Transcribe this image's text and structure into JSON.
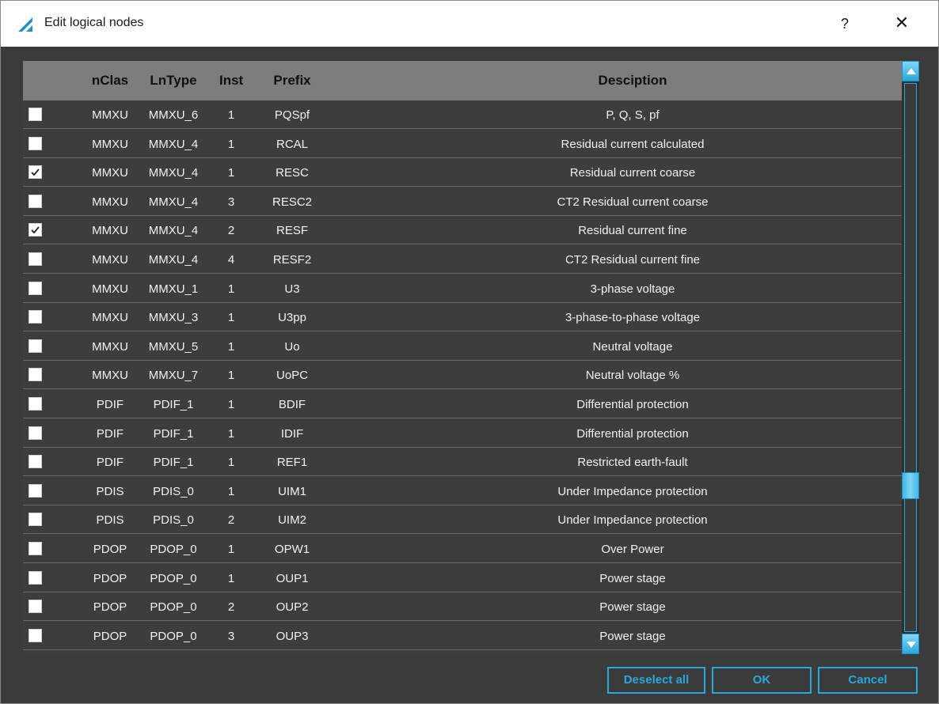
{
  "window": {
    "title": "Edit logical nodes",
    "help_label": "?",
    "close_label": "✕"
  },
  "table": {
    "headers": {
      "nclass": "nClas",
      "lntype": "LnType",
      "inst": "Inst",
      "prefix": "Prefix",
      "description": "Desciption"
    },
    "rows": [
      {
        "checked": false,
        "nclass": "MMXU",
        "lntype": "MMXU_6",
        "inst": "1",
        "prefix": "PQSpf",
        "description": "P, Q, S, pf"
      },
      {
        "checked": false,
        "nclass": "MMXU",
        "lntype": "MMXU_4",
        "inst": "1",
        "prefix": "RCAL",
        "description": "Residual current calculated"
      },
      {
        "checked": true,
        "nclass": "MMXU",
        "lntype": "MMXU_4",
        "inst": "1",
        "prefix": "RESC",
        "description": "Residual current coarse"
      },
      {
        "checked": false,
        "nclass": "MMXU",
        "lntype": "MMXU_4",
        "inst": "3",
        "prefix": "RESC2",
        "description": "CT2 Residual current coarse"
      },
      {
        "checked": true,
        "nclass": "MMXU",
        "lntype": "MMXU_4",
        "inst": "2",
        "prefix": "RESF",
        "description": "Residual current fine"
      },
      {
        "checked": false,
        "nclass": "MMXU",
        "lntype": "MMXU_4",
        "inst": "4",
        "prefix": "RESF2",
        "description": "CT2 Residual current fine"
      },
      {
        "checked": false,
        "nclass": "MMXU",
        "lntype": "MMXU_1",
        "inst": "1",
        "prefix": "U3",
        "description": "3-phase voltage"
      },
      {
        "checked": false,
        "nclass": "MMXU",
        "lntype": "MMXU_3",
        "inst": "1",
        "prefix": "U3pp",
        "description": "3-phase-to-phase voltage"
      },
      {
        "checked": false,
        "nclass": "MMXU",
        "lntype": "MMXU_5",
        "inst": "1",
        "prefix": "Uo",
        "description": "Neutral voltage"
      },
      {
        "checked": false,
        "nclass": "MMXU",
        "lntype": "MMXU_7",
        "inst": "1",
        "prefix": "UoPC",
        "description": "Neutral voltage %"
      },
      {
        "checked": false,
        "nclass": "PDIF",
        "lntype": "PDIF_1",
        "inst": "1",
        "prefix": "BDIF",
        "description": "Differential protection"
      },
      {
        "checked": false,
        "nclass": "PDIF",
        "lntype": "PDIF_1",
        "inst": "1",
        "prefix": "IDIF",
        "description": "Differential protection"
      },
      {
        "checked": false,
        "nclass": "PDIF",
        "lntype": "PDIF_1",
        "inst": "1",
        "prefix": "REF1",
        "description": "Restricted earth-fault"
      },
      {
        "checked": false,
        "nclass": "PDIS",
        "lntype": "PDIS_0",
        "inst": "1",
        "prefix": "UIM1",
        "description": "Under Impedance protection"
      },
      {
        "checked": false,
        "nclass": "PDIS",
        "lntype": "PDIS_0",
        "inst": "2",
        "prefix": "UIM2",
        "description": "Under Impedance protection"
      },
      {
        "checked": false,
        "nclass": "PDOP",
        "lntype": "PDOP_0",
        "inst": "1",
        "prefix": "OPW1",
        "description": "Over Power"
      },
      {
        "checked": false,
        "nclass": "PDOP",
        "lntype": "PDOP_0",
        "inst": "1",
        "prefix": "OUP1",
        "description": "Power stage"
      },
      {
        "checked": false,
        "nclass": "PDOP",
        "lntype": "PDOP_0",
        "inst": "2",
        "prefix": "OUP2",
        "description": "Power stage"
      },
      {
        "checked": false,
        "nclass": "PDOP",
        "lntype": "PDOP_0",
        "inst": "3",
        "prefix": "OUP3",
        "description": "Power stage"
      }
    ]
  },
  "buttons": {
    "deselect_all": "Deselect all",
    "ok": "OK",
    "cancel": "Cancel"
  },
  "colors": {
    "accent": "#2aa7dc",
    "background": "#3d3d3d",
    "header": "#7d7d7d"
  },
  "icons": {
    "app": "triangle-logo-icon",
    "checkbox_checked": "check-icon"
  }
}
